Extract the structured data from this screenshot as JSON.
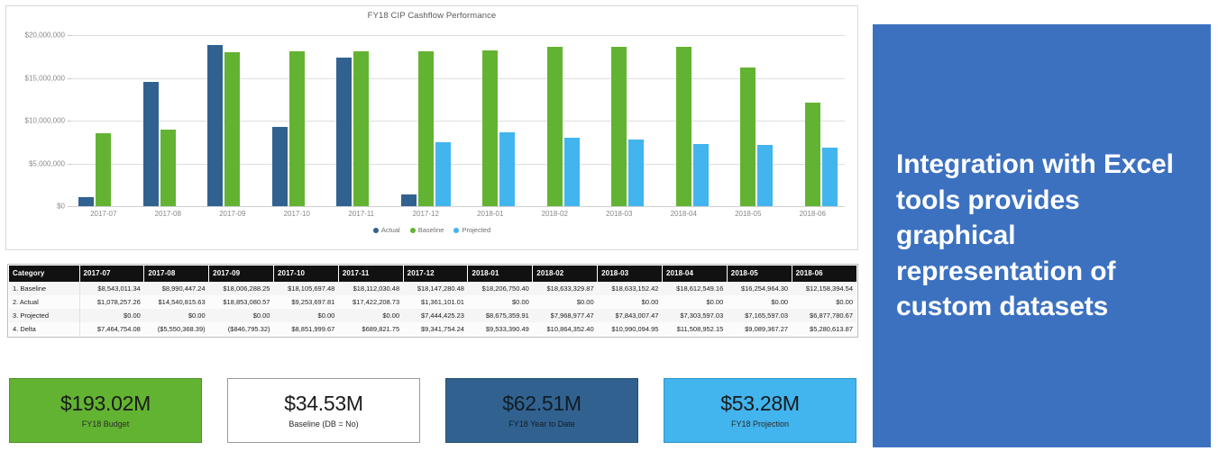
{
  "callout": {
    "text": "Integration with Excel tools provides graphical representation of custom datasets",
    "background_color": "#3C71C0",
    "text_color": "#FFFFFF"
  },
  "chart_data": {
    "type": "bar",
    "title": "FY18 CIP Cashflow Performance",
    "xlabel": "",
    "ylabel": "",
    "ylim": [
      0,
      20000000
    ],
    "grid": true,
    "legend_position": "bottom",
    "ytick_labels": [
      "$0",
      "$5,000,000",
      "$10,000,000",
      "$15,000,000",
      "$20,000,000"
    ],
    "ytick_values": [
      0,
      5000000,
      10000000,
      15000000,
      20000000
    ],
    "categories": [
      "2017-07",
      "2017-08",
      "2017-09",
      "2017-10",
      "2017-11",
      "2017-12",
      "2018-01",
      "2018-02",
      "2018-03",
      "2018-04",
      "2018-05",
      "2018-06"
    ],
    "series": [
      {
        "name": "Actual",
        "color": "#31628F",
        "values": [
          1078257.26,
          14540815.63,
          18853080.57,
          9253697.81,
          17422208.73,
          1361101.01,
          0,
          0,
          0,
          0,
          0,
          0
        ]
      },
      {
        "name": "Baseline",
        "color": "#63B332",
        "values": [
          8543011.34,
          8990447.24,
          18006288.25,
          18105697.48,
          18112030.48,
          18147280.48,
          18206750.4,
          18633329.87,
          18633152.42,
          18612549.16,
          16254964.3,
          12158394.54
        ]
      },
      {
        "name": "Projected",
        "color": "#42B4EE",
        "values": [
          0,
          0,
          0,
          0,
          0,
          7444425.23,
          8675359.91,
          7968977.47,
          7843007.47,
          7303597.03,
          7165597.03,
          6877780.67
        ]
      }
    ]
  },
  "table": {
    "columns": [
      "Category",
      "2017-07",
      "2017-08",
      "2017-09",
      "2017-10",
      "2017-11",
      "2017-12",
      "2018-01",
      "2018-02",
      "2018-03",
      "2018-04",
      "2018-05",
      "2018-06"
    ],
    "rows": [
      {
        "category": "1. Baseline",
        "cells": [
          "$8,543,011.34",
          "$8,990,447.24",
          "$18,006,288.25",
          "$18,105,697.48",
          "$18,112,030.48",
          "$18,147,280.48",
          "$18,206,750.40",
          "$18,633,329.87",
          "$18,633,152.42",
          "$18,612,549.16",
          "$16,254,964.30",
          "$12,158,394.54"
        ]
      },
      {
        "category": "2. Actual",
        "cells": [
          "$1,078,257.26",
          "$14,540,815.63",
          "$18,853,080.57",
          "$9,253,697.81",
          "$17,422,208.73",
          "$1,361,101.01",
          "$0.00",
          "$0.00",
          "$0.00",
          "$0.00",
          "$0.00",
          "$0.00"
        ]
      },
      {
        "category": "3. Projected",
        "cells": [
          "$0.00",
          "$0.00",
          "$0.00",
          "$0.00",
          "$0.00",
          "$7,444,425.23",
          "$8,675,359.91",
          "$7,968,977.47",
          "$7,843,007.47",
          "$7,303,597.03",
          "$7,165,597.03",
          "$6,877,780.67"
        ]
      },
      {
        "category": "4. Delta",
        "cells": [
          "$7,464,754.08",
          "($5,550,368.39)",
          "($846,795.32)",
          "$8,851,999.67",
          "$689,821.75",
          "$9,341,754.24",
          "$9,533,390.49",
          "$10,864,352.40",
          "$10,990,094.95",
          "$11,508,952.15",
          "$9,089,367.27",
          "$5,280,613.87"
        ]
      }
    ]
  },
  "kpis": [
    {
      "value": "$193.02M",
      "label": "FY18 Budget",
      "color": "#63B332",
      "style": "green"
    },
    {
      "value": "$34.53M",
      "label": "Baseline (DB = No)",
      "color": "#FFFFFF",
      "style": "white"
    },
    {
      "value": "$62.51M",
      "label": "FY18 Year to Date",
      "color": "#31628F",
      "style": "navy"
    },
    {
      "value": "$53.28M",
      "label": "FY18 Projection",
      "color": "#42B4EE",
      "style": "sky"
    }
  ]
}
